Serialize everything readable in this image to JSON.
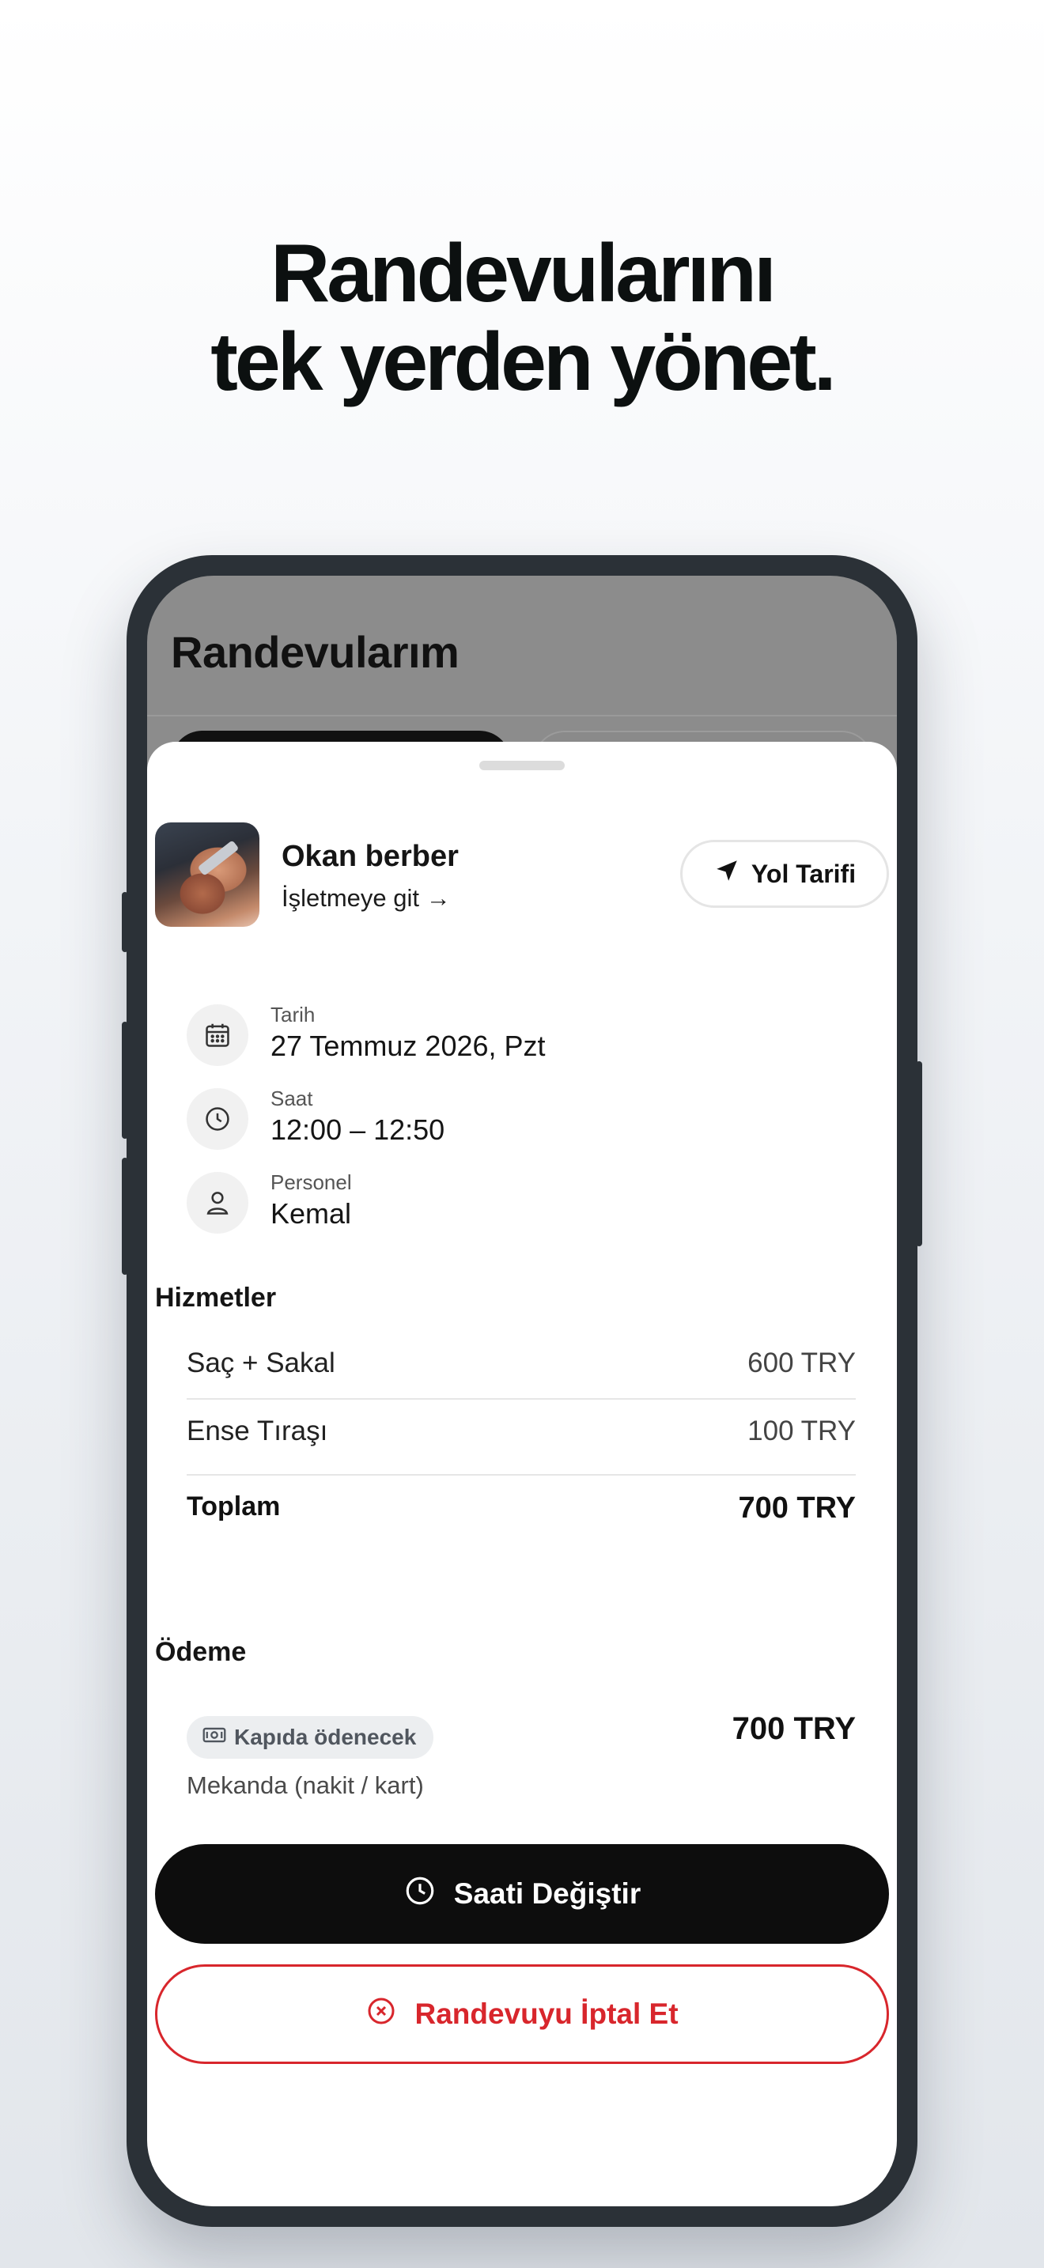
{
  "headline": {
    "line1": "Randevularını",
    "line2": "tek yerden yönet."
  },
  "screen": {
    "title": "Randevularım"
  },
  "business": {
    "name": "Okan berber",
    "link": "İşletmeye git →",
    "route_button": "Yol Tarifi",
    "photo_icon": "barber-photo"
  },
  "details": [
    {
      "icon": "calendar-icon",
      "label": "Tarih",
      "value": "27 Temmuz 2026, Pzt"
    },
    {
      "icon": "clock-icon",
      "label": "Saat",
      "value": "12:00 – 12:50"
    },
    {
      "icon": "person-icon",
      "label": "Personel",
      "value": "Kemal"
    }
  ],
  "services": {
    "title": "Hizmetler",
    "items": [
      {
        "name": "Saç + Sakal",
        "price": "600 TRY"
      },
      {
        "name": "Ense Tıraşı",
        "price": "100 TRY"
      }
    ],
    "total_label": "Toplam",
    "total_value": "700 TRY"
  },
  "payment": {
    "title": "Ödeme",
    "badge": "Kapıda ödenecek",
    "amount": "700 TRY",
    "method": "Mekanda (nakit / kart)"
  },
  "actions": {
    "change_time": "Saati Değiştir",
    "cancel": "Randevuyu İptal Et"
  },
  "colors": {
    "primary": "#0d0d0d",
    "danger": "#d8262c",
    "phone_frame": "#2b3137"
  }
}
